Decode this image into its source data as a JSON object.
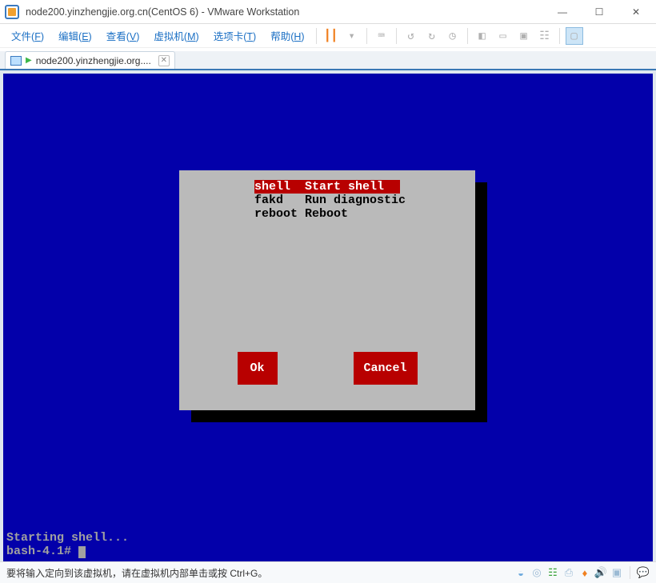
{
  "window": {
    "title": "node200.yinzhengjie.org.cn(CentOS 6) - VMware Workstation",
    "controls": {
      "min": "—",
      "max": "☐",
      "close": "✕"
    }
  },
  "menus": {
    "file": {
      "label": "文件",
      "accel": "F"
    },
    "edit": {
      "label": "编辑",
      "accel": "E"
    },
    "view": {
      "label": "查看",
      "accel": "V"
    },
    "vm": {
      "label": "虚拟机",
      "accel": "M"
    },
    "tabs": {
      "label": "选项卡",
      "accel": "T"
    },
    "help": {
      "label": "帮助",
      "accel": "H"
    }
  },
  "tab": {
    "label": "node200.yinzhengjie.org...."
  },
  "dialog": {
    "items": [
      {
        "key": "shell ",
        "desc": "Start shell",
        "selected": true
      },
      {
        "key": "fakd  ",
        "desc": "Run diagnostic",
        "selected": false
      },
      {
        "key": "reboot",
        "desc": "Reboot",
        "selected": false
      }
    ],
    "ok": "Ok",
    "cancel": "Cancel"
  },
  "terminal": {
    "line1": "Starting shell...",
    "line2": "bash-4.1#"
  },
  "status": {
    "hint": "要将输入定向到该虚拟机，请在虚拟机内部单击或按 Ctrl+G。"
  }
}
